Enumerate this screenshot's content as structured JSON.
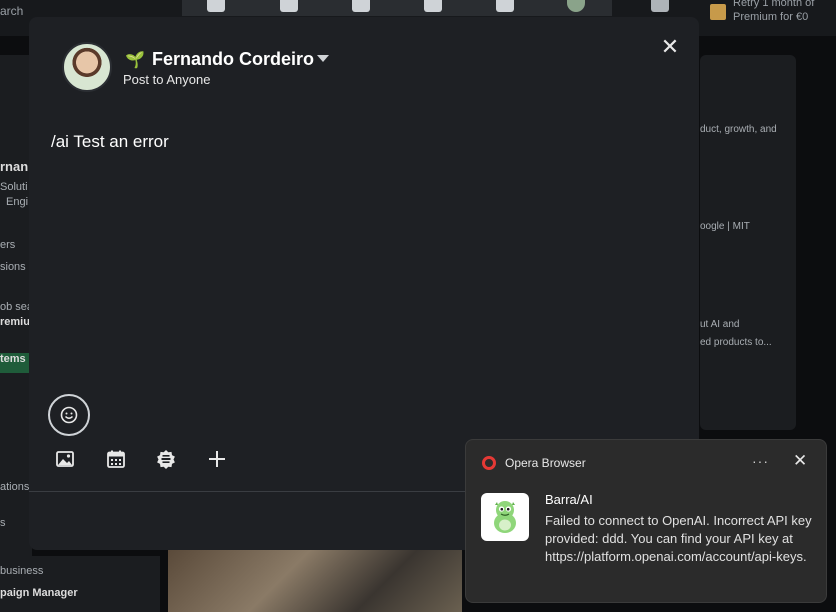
{
  "background": {
    "search_fragment": "arch",
    "premium_text": "Retry 1 month of Premium for €0",
    "left_fragments": [
      "rnan",
      "Soluti",
      "Engi",
      "ers",
      "sions",
      "ob sea",
      "remiu",
      "tems",
      "ations",
      "s"
    ],
    "bottom_left": [
      "business",
      "paign Manager"
    ],
    "right_fragments": [
      "duct, growth, and",
      "oogle | MIT",
      "ut AI and",
      "ed products to..."
    ]
  },
  "composer": {
    "author_name": "Fernando Cordeiro",
    "audience": "Post to Anyone",
    "post_text": "/ai Test an error",
    "close_icon": "close-icon",
    "toolbar_icons": [
      "image-icon",
      "calendar-icon",
      "badge-icon",
      "plus-icon"
    ]
  },
  "notification": {
    "app_name": "Opera Browser",
    "more_label": "···",
    "close_label": "✕",
    "title": "Barra/AI",
    "body": "Failed to connect to OpenAI. Incorrect API key provided: ddd. You can find your API key at https://platform.openai.com/account/api-keys."
  }
}
